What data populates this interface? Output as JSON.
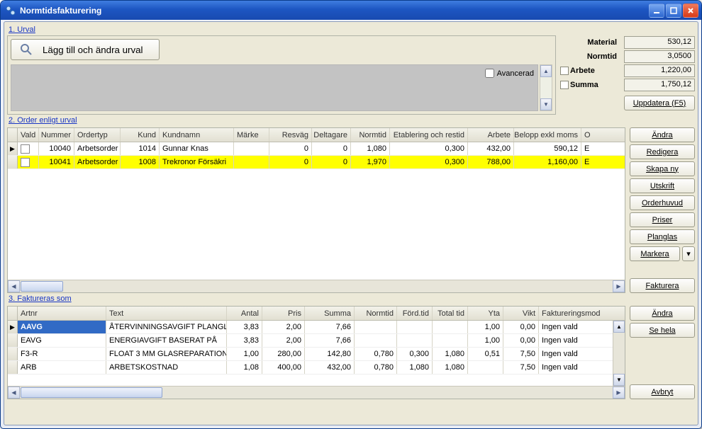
{
  "window": {
    "title": "Normtidsfakturering"
  },
  "sections": {
    "urval": "1. Urval",
    "order": "2. Order enligt urval",
    "fakt": "3. Faktureras som"
  },
  "urval": {
    "add_label": "Lägg till och ändra urval",
    "advanced_label": "Avancerad"
  },
  "summary": {
    "material_label": "Material",
    "material_val": "530,12",
    "normtid_label": "Normtid",
    "normtid_val": "3,0500",
    "arbete_label": "Arbete",
    "arbete_val": "1,220,00",
    "summa_label": "Summa",
    "summa_val": "1,750,12",
    "update_label": "Uppdatera (F5)"
  },
  "order_headers": {
    "vald": "Vald",
    "nummer": "Nummer",
    "ordertyp": "Ordertyp",
    "kund": "Kund",
    "kundnamn": "Kundnamn",
    "marke": "Märke",
    "resvag": "Resväg",
    "deltagare": "Deltagare",
    "normtid": "Normtid",
    "etabl": "Etablering och restid",
    "arbete": "Arbete",
    "belopp": "Belopp exkl moms",
    "o": "O"
  },
  "order_rows": [
    {
      "nummer": "10040",
      "ordertyp": "Arbetsorder",
      "kund": "1014",
      "kundnamn": "Gunnar Knas",
      "marke": "",
      "resvag": "0",
      "deltagare": "0",
      "normtid": "1,080",
      "etabl": "0,300",
      "arbete": "432,00",
      "belopp": "590,12",
      "o": "E",
      "hl": "white",
      "ind": "▶"
    },
    {
      "nummer": "10041",
      "ordertyp": "Arbetsorder",
      "kund": "1008",
      "kundnamn": "Trekronor Försäkri",
      "marke": "",
      "resvag": "0",
      "deltagare": "0",
      "normtid": "1,970",
      "etabl": "0,300",
      "arbete": "788,00",
      "belopp": "1,160,00",
      "o": "E",
      "hl": "yellow",
      "ind": ""
    }
  ],
  "side_buttons": {
    "andra": "Ändra",
    "redigera": "Redigera",
    "skapa": "Skapa ny",
    "utskrift": "Utskrift",
    "orderhuvud": "Orderhuvud",
    "priser": "Priser",
    "planglas": "Planglas",
    "markera": "Markera",
    "fakturera": "Fakturera"
  },
  "fakt_headers": {
    "artnr": "Artnr",
    "text": "Text",
    "antal": "Antal",
    "pris": "Pris",
    "summa": "Summa",
    "normtid": "Normtid",
    "ford": "Förd.tid",
    "total": "Total tid",
    "yta": "Yta",
    "vikt": "Vikt",
    "mode": "Faktureringsmod"
  },
  "fakt_rows": [
    {
      "artnr": "AAVG",
      "text": "ÅTERVINNINGSAVGIFT PLANGLAS",
      "antal": "3,83",
      "pris": "2,00",
      "summa": "7,66",
      "normtid": "",
      "ford": "",
      "total": "",
      "yta": "1,00",
      "vikt": "0,00",
      "mode": "Ingen vald",
      "sel": true,
      "ind": "▶"
    },
    {
      "artnr": "EAVG",
      "text": "ENERGIAVGIFT BASERAT PÅ",
      "antal": "3,83",
      "pris": "2,00",
      "summa": "7,66",
      "normtid": "",
      "ford": "",
      "total": "",
      "yta": "1,00",
      "vikt": "0,00",
      "mode": "Ingen vald"
    },
    {
      "artnr": "F3-R",
      "text": "FLOAT 3 MM  GLASREPARATION",
      "antal": "1,00",
      "pris": "280,00",
      "summa": "142,80",
      "normtid": "0,780",
      "ford": "0,300",
      "total": "1,080",
      "yta": "0,51",
      "vikt": "7,50",
      "mode": "Ingen vald"
    },
    {
      "artnr": "ARB",
      "text": "ARBETSKOSTNAD",
      "antal": "1,08",
      "pris": "400,00",
      "summa": "432,00",
      "normtid": "0,780",
      "ford": "1,080",
      "total": "1,080",
      "yta": "",
      "vikt": "7,50",
      "mode": "Ingen vald"
    }
  ],
  "side_buttons2": {
    "andra": "Ändra",
    "sehela": "Se hela",
    "avbryt": "Avbryt"
  }
}
